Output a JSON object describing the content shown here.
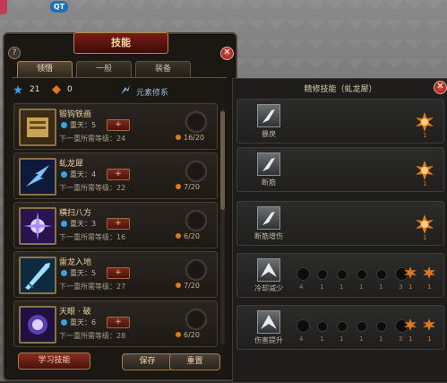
{
  "hud": {
    "qt_badge": "QT"
  },
  "skills_window": {
    "title": "技能",
    "help_symbol": "?",
    "close_symbol": "✕",
    "tabs": [
      {
        "label": "领悟",
        "active": true
      },
      {
        "label": "一般",
        "active": false
      },
      {
        "label": "装备",
        "active": false
      }
    ],
    "points": {
      "blue": "21",
      "orange": "0"
    },
    "element_label": "元素修系",
    "skills": [
      {
        "name": "锻钩铁画",
        "level": "重天：5",
        "requirement": "下一重所需等级：24",
        "progress": "16/20",
        "plus": "+",
        "icon_color": "gold"
      },
      {
        "name": "虬龙犀",
        "level": "重天：4",
        "requirement": "下一重所需等级：22",
        "progress": "7/20",
        "plus": "+",
        "icon_color": "blue"
      },
      {
        "name": "横扫八方",
        "level": "重天：3",
        "requirement": "下一重所需等级：16",
        "progress": "6/20",
        "plus": "+",
        "icon_color": "purple"
      },
      {
        "name": "雷龙入地",
        "level": "重天：5",
        "requirement": "下一重所需等级：27",
        "progress": "7/20",
        "plus": "+",
        "icon_color": "cyan"
      },
      {
        "name": "天眼 · 破",
        "level": "重天：6",
        "requirement": "下一重所需等级：28",
        "progress": "6/20",
        "plus": "+",
        "icon_color": "violet"
      }
    ],
    "buttons": {
      "learn": "学习技能",
      "save": "保存",
      "reset": "重置"
    }
  },
  "mastery_window": {
    "title": "精修技能（虬龙犀）",
    "close_symbol": "✕",
    "rows": [
      {
        "label": "暴戾",
        "star_count": "1"
      },
      {
        "label": "断筋",
        "star_count": "1"
      },
      {
        "label": "断筋增伤",
        "star_count": "1"
      },
      {
        "label": "冷却减少",
        "nodes": [
          "4",
          "1",
          "1",
          "1",
          "1",
          "3",
          "1",
          "1"
        ]
      },
      {
        "label": "伤害提升",
        "nodes": [
          "4",
          "1",
          "1",
          "1",
          "1",
          "3",
          "1",
          "1"
        ]
      }
    ]
  },
  "colors": {
    "accent_red": "#8b2b1b",
    "gold_border": "#8b7348",
    "orange": "#e0781e",
    "blue": "#3aa3e3"
  }
}
